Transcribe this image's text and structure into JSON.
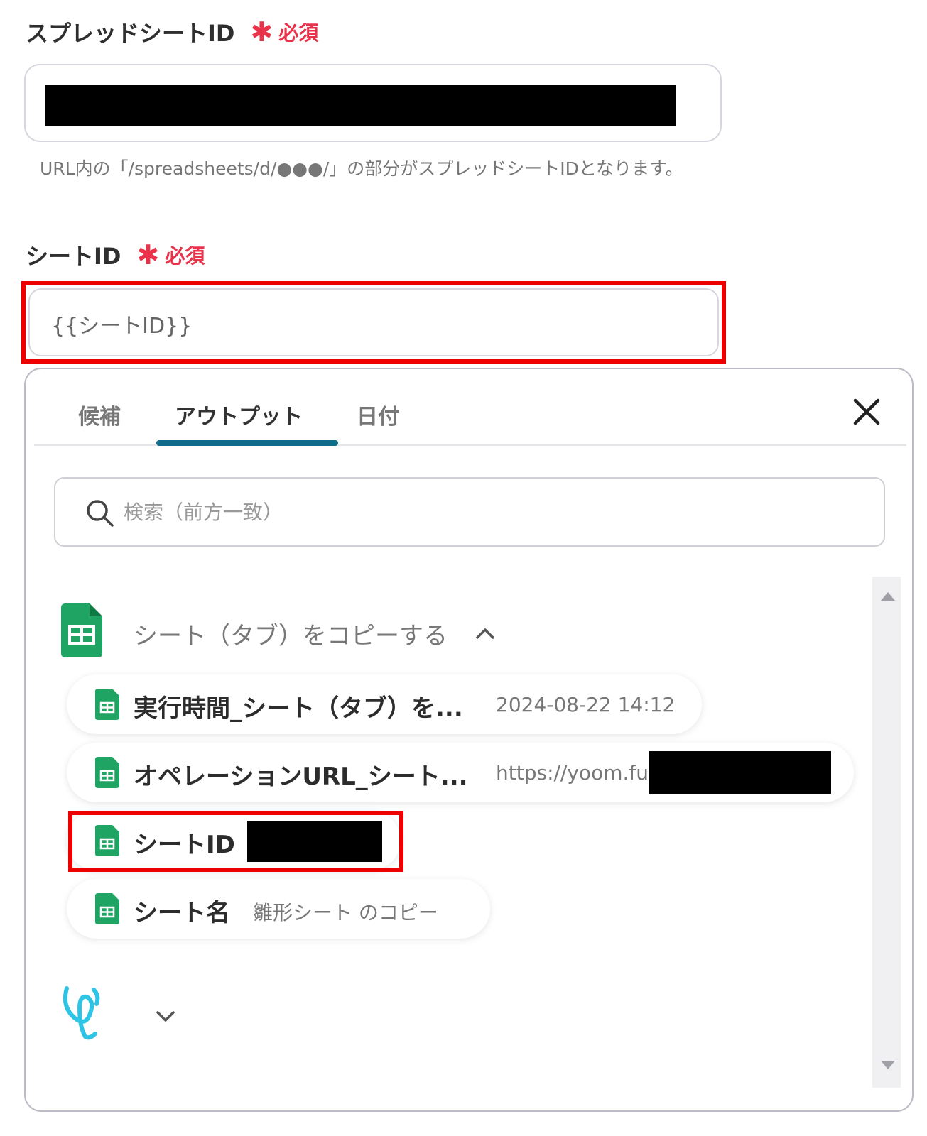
{
  "spreadsheet_field": {
    "label": "スプレッドシートID",
    "required_mark": "✱",
    "required_text": "必須",
    "hint": "URL内の「/spreadsheets/d/●●●/」の部分がスプレッドシートIDとなります。"
  },
  "sheet_field": {
    "label": "シートID",
    "required_mark": "✱",
    "required_text": "必須",
    "value": "{{シートID}}"
  },
  "panel": {
    "tabs": [
      {
        "label": "候補"
      },
      {
        "label": "アウトプット"
      },
      {
        "label": "日付"
      }
    ],
    "active_tab": "アウトプット",
    "search_placeholder": "検索（前方一致）",
    "group": {
      "title": "シート（タブ）をコピーする",
      "items": [
        {
          "name": "実行時間_シート（タブ）を...",
          "value": "2024-08-22 14:12"
        },
        {
          "name": "オペレーションURL_シート...",
          "value": "https://yoom.fun"
        },
        {
          "name": "シートID",
          "value": ""
        },
        {
          "name": "シート名",
          "value": "雛形シート のコピー"
        }
      ]
    }
  },
  "colors": {
    "required": "#e8334a",
    "highlight": "#ee0000",
    "tab_underline": "#116b8a",
    "sheets_green": "#1fa463",
    "yoom_cyan": "#2ec4e6"
  }
}
